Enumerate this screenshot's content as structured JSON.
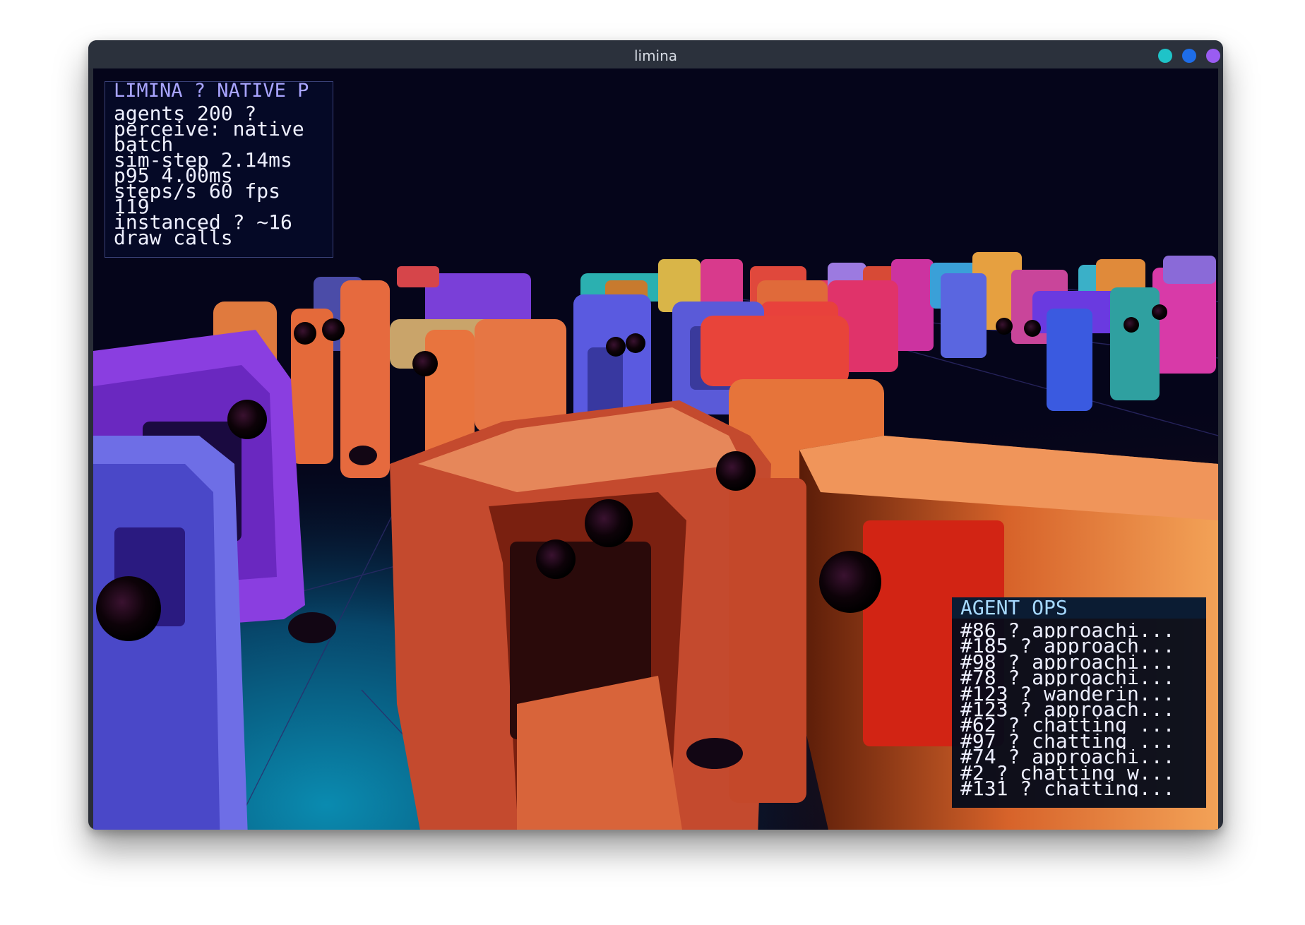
{
  "window": {
    "title": "limina",
    "controls": [
      {
        "name": "minimize",
        "color": "#1fc3c8"
      },
      {
        "name": "maximize",
        "color": "#1e6de8"
      },
      {
        "name": "close",
        "color": "#9a5cf2"
      }
    ]
  },
  "hud_stats": {
    "title": "LIMINA ? NATIVE P",
    "lines": [
      "agents 200  ?",
      "perceive: native batch",
      "sim-step 2.14ms",
      "p95 4.00ms",
      "steps/s 60   fps 119",
      "instanced ? ~16 draw calls"
    ]
  },
  "agent_ops": {
    "title": "AGENT OPS",
    "items": [
      "#86 ? approachi...",
      "#185 ? approach...",
      "#98 ? approachi...",
      "#78 ? approachi...",
      "#123 ? wanderin...",
      "#123 ? approach...",
      "#62 ? chatting ...",
      "#97 ? chatting ...",
      "#74 ? approachi...",
      "#2 ? chatting w...",
      "#131 ? chatting..."
    ]
  }
}
